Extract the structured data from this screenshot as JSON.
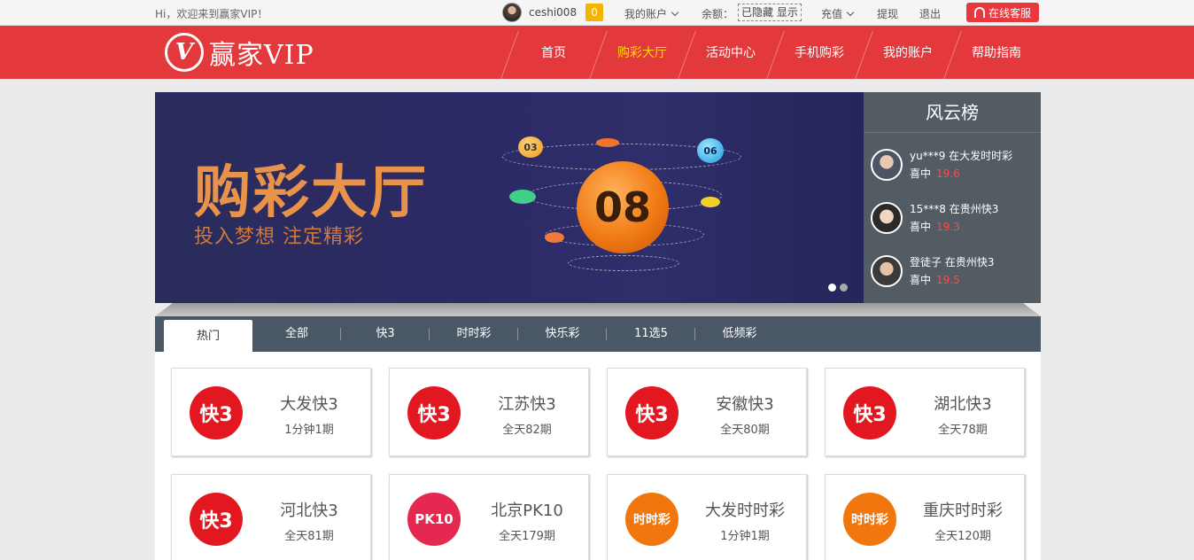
{
  "topbar": {
    "welcome": "Hi，欢迎来到赢家VIP！",
    "username": "ceshi008",
    "message_count": "0",
    "my_account": "我的账户",
    "balance_label": "余额：",
    "balance_value": "已隐藏 显示",
    "recharge": "充值",
    "withdraw": "提现",
    "logout": "退出",
    "online_service": "在线客服"
  },
  "header": {
    "logo_mark": "V",
    "logo_text": "赢家VIP",
    "nav": [
      "首页",
      "购彩大厅",
      "活动中心",
      "手机购彩",
      "我的账户",
      "帮助指南"
    ],
    "active_nav": "购彩大厅"
  },
  "banner": {
    "title": "购彩大厅",
    "subtitle": "投入梦想  注定精彩",
    "main_ball": "08",
    "ball_a": "03",
    "ball_b": "06"
  },
  "ranking": {
    "title": "风云榜",
    "items": [
      {
        "line1": "yu***9 在大发时时彩",
        "label": "喜中",
        "amount": "19.6"
      },
      {
        "line1": "15***8 在贵州快3",
        "label": "喜中",
        "amount": "19.3"
      },
      {
        "line1": "登徒子 在贵州快3",
        "label": "喜中",
        "amount": "19.5"
      }
    ]
  },
  "tabs": [
    "热门",
    "全部",
    "快3",
    "时时彩",
    "快乐彩",
    "11选5",
    "低频彩"
  ],
  "games": [
    {
      "name": "大发快3",
      "desc": "1分钟1期",
      "icon": "快3"
    },
    {
      "name": "江苏快3",
      "desc": "全天82期",
      "icon": "快3"
    },
    {
      "name": "安徽快3",
      "desc": "全天80期",
      "icon": "快3"
    },
    {
      "name": "湖北快3",
      "desc": "全天78期",
      "icon": "快3"
    },
    {
      "name": "河北快3",
      "desc": "全天81期",
      "icon": "快3"
    },
    {
      "name": "北京PK10",
      "desc": "全天179期",
      "icon": "PK10"
    },
    {
      "name": "大发时时彩",
      "desc": "1分钟1期",
      "icon": "时时彩"
    },
    {
      "name": "重庆时时彩",
      "desc": "全天120期",
      "icon": "时时彩"
    }
  ]
}
